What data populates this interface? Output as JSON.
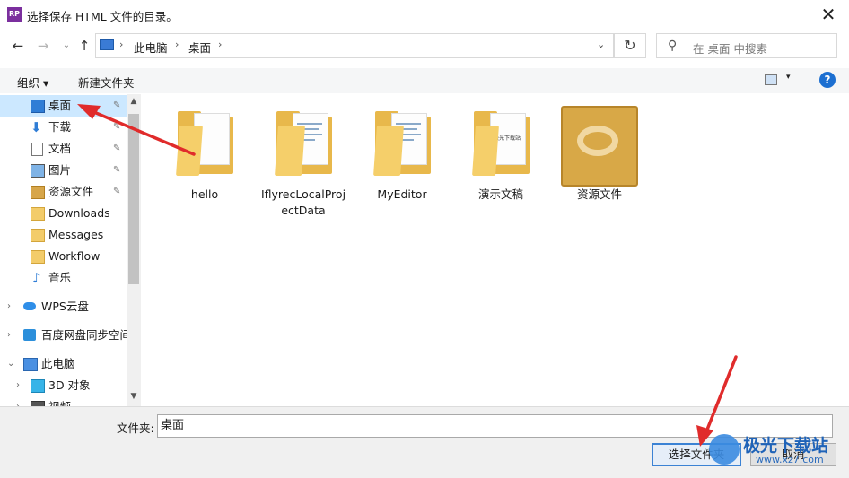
{
  "window": {
    "title": "选择保存 HTML 文件的目录。",
    "app_icon_text": "RP",
    "close_glyph": "✕"
  },
  "nav": {
    "back": "←",
    "forward": "→",
    "recent": "⌄",
    "up": "↑",
    "breadcrumb": [
      "此电脑",
      "桌面"
    ],
    "breadcrumb_sep": "›",
    "dropdown": "⌄",
    "refresh": "↻",
    "search_placeholder": "在 桌面 中搜索",
    "search_icon": "⚲"
  },
  "toolbar": {
    "organize": "组织 ▾",
    "new_folder": "新建文件夹",
    "view_dd": "▾",
    "help": "?"
  },
  "sidebar": {
    "quick_access": [
      {
        "label": "桌面",
        "icon": "desktop-icon",
        "pinned": true,
        "selected": true
      },
      {
        "label": "下载",
        "icon": "download-icon",
        "pinned": true
      },
      {
        "label": "文档",
        "icon": "documents-icon",
        "pinned": true
      },
      {
        "label": "图片",
        "icon": "pictures-icon",
        "pinned": true
      },
      {
        "label": "资源文件",
        "icon": "folder-icon",
        "pinned": true
      },
      {
        "label": "Downloads",
        "icon": "folder-icon"
      },
      {
        "label": "Messages",
        "icon": "folder-icon"
      },
      {
        "label": "Workflow",
        "icon": "folder-icon"
      },
      {
        "label": "音乐",
        "icon": "music-icon"
      }
    ],
    "roots": [
      {
        "label": "WPS云盘",
        "icon": "cloud-icon",
        "expander": "›"
      },
      {
        "label": "百度网盘同步空间",
        "icon": "baidu-sync-icon",
        "expander": "›"
      },
      {
        "label": "此电脑",
        "icon": "pc-icon",
        "expander": "⌄"
      },
      {
        "label": "3D 对象",
        "icon": "3d-objects-icon",
        "expander": "›"
      },
      {
        "label": "视频",
        "icon": "video-icon",
        "expander": "›"
      }
    ],
    "pin_glyph": "📌",
    "scroll_up": "▲",
    "scroll_down": "▼"
  },
  "files": [
    {
      "label": "hello",
      "kind": "folder-doc"
    },
    {
      "label": "IflyrecLocalProjectData",
      "kind": "folder-docs"
    },
    {
      "label": "MyEditor",
      "kind": "folder-docs"
    },
    {
      "label": "演示文稿",
      "kind": "folder-paper",
      "paper_text": "极光下载站"
    },
    {
      "label": "资源文件",
      "kind": "baidu"
    }
  ],
  "bottom": {
    "folder_label": "文件夹:",
    "folder_value": "桌面",
    "select_button": "选择文件夹",
    "cancel_button": "取消"
  },
  "watermark": {
    "text": "极光下载站",
    "url": "www.xz7.com"
  },
  "colors": {
    "selected_bg": "#cce8ff",
    "arrow_red": "#e02b2b",
    "accent": "#3b82d4"
  }
}
